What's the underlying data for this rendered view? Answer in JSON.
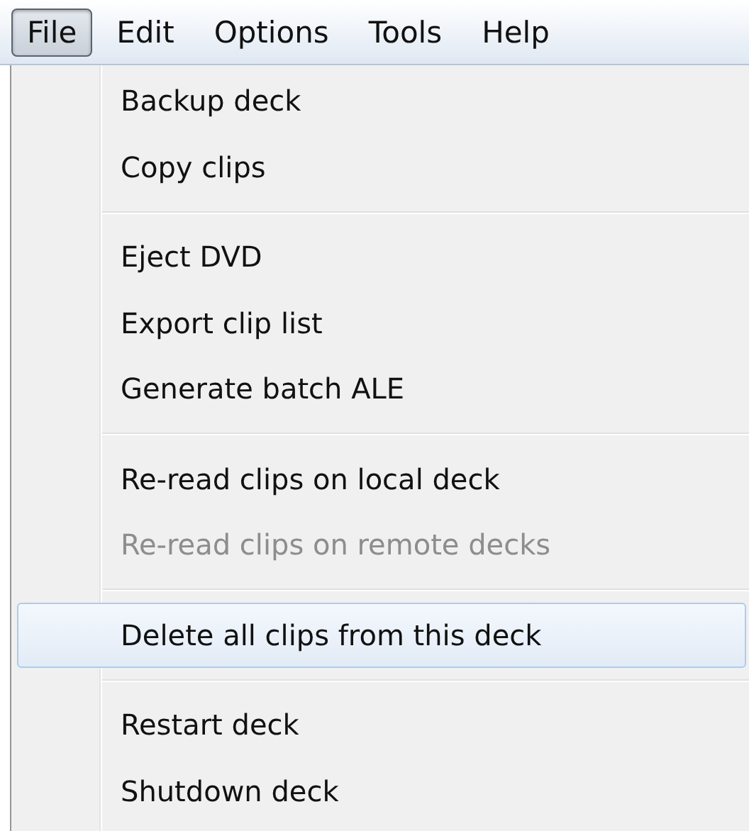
{
  "menubar": [
    {
      "label": "File",
      "selected": true
    },
    {
      "label": "Edit",
      "selected": false
    },
    {
      "label": "Options",
      "selected": false
    },
    {
      "label": "Tools",
      "selected": false
    },
    {
      "label": "Help",
      "selected": false
    }
  ],
  "menu": {
    "groups": [
      {
        "items": [
          {
            "label": "Backup deck",
            "disabled": false,
            "selected": false
          },
          {
            "label": "Copy clips",
            "disabled": false,
            "selected": false
          }
        ]
      },
      {
        "items": [
          {
            "label": "Eject DVD",
            "disabled": false,
            "selected": false
          },
          {
            "label": "Export clip list",
            "disabled": false,
            "selected": false
          },
          {
            "label": "Generate batch ALE",
            "disabled": false,
            "selected": false
          }
        ]
      },
      {
        "items": [
          {
            "label": "Re-read clips on local deck",
            "disabled": false,
            "selected": false
          },
          {
            "label": "Re-read clips on remote decks",
            "disabled": true,
            "selected": false
          }
        ]
      },
      {
        "items": [
          {
            "label": "Delete all clips from this deck",
            "disabled": false,
            "selected": true
          }
        ]
      },
      {
        "items": [
          {
            "label": "Restart deck",
            "disabled": false,
            "selected": false
          },
          {
            "label": "Shutdown deck",
            "disabled": false,
            "selected": false
          }
        ]
      }
    ]
  }
}
